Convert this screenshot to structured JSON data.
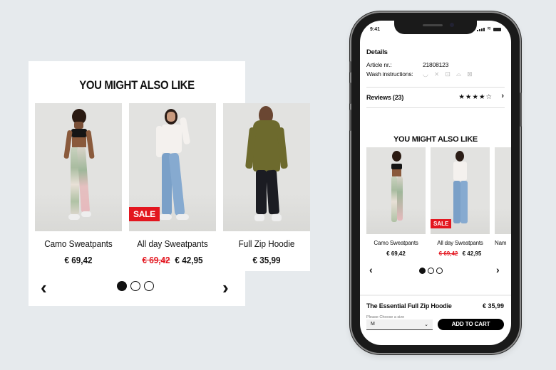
{
  "desktop_widget": {
    "title": "YOU MIGHT ALSO LIKE",
    "products": [
      {
        "name": "Camo Sweatpants",
        "price": "€ 69,42",
        "old_price": null,
        "badge": null
      },
      {
        "name": "All day Sweatpants",
        "price": "€ 42,95",
        "old_price": "€ 69,42",
        "badge": "SALE"
      },
      {
        "name": "Full Zip Hoodie",
        "price": "€ 35,99",
        "old_price": null,
        "badge": null
      }
    ],
    "pagination": {
      "total": 3,
      "active": 1
    },
    "prev_icon": "‹",
    "next_icon": "›"
  },
  "phone": {
    "status_bar": {
      "time": "9:41",
      "icons": [
        "signal-icon",
        "wifi-icon",
        "battery-icon"
      ]
    },
    "details": {
      "heading": "Details",
      "article_label": "Article nr.:",
      "article_value": "21808123",
      "wash_label": "Wash instructions:",
      "wash_icons": [
        "wash-tub-icon",
        "no-bleach-icon",
        "tumble-dry-icon",
        "iron-icon",
        "no-dry-clean-icon"
      ]
    },
    "reviews": {
      "label": "Reviews (23)",
      "rating": 4,
      "max_rating": 5,
      "stars_text": "★★★★☆",
      "chevron": "›"
    },
    "recommendations": {
      "title": "YOU MIGHT ALSO LIKE",
      "products": [
        {
          "name": "Camo Sweatpants",
          "price": "€ 69,42",
          "old_price": null,
          "badge": null
        },
        {
          "name": "All day Sweatpants",
          "price": "€ 42,95",
          "old_price": "€ 69,42",
          "badge": "SALE"
        },
        {
          "name": "Nam",
          "price": "",
          "old_price": null,
          "badge": null
        }
      ],
      "pagination": {
        "total": 3,
        "active": 1
      },
      "prev_icon": "‹",
      "next_icon": "›"
    },
    "buy_bar": {
      "product_name": "The Essential Full Zip Hoodie",
      "price": "€ 35,99",
      "size_label": "Please Choose a size",
      "size_value": "M",
      "add_to_cart": "ADD TO CART"
    }
  },
  "colors": {
    "background": "#e6eaed",
    "sale_red": "#e3161f",
    "text": "#111111",
    "button": "#000000"
  }
}
